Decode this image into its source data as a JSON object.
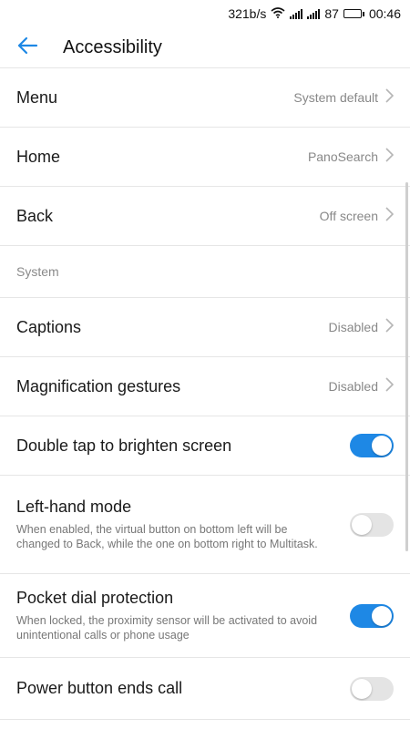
{
  "status_bar": {
    "speed": "321b/s",
    "battery": "87",
    "battery_level": 0.87,
    "time": "00:46"
  },
  "app_bar": {
    "title": "Accessibility"
  },
  "nav_rows": [
    {
      "label": "Menu",
      "value": "System default"
    },
    {
      "label": "Home",
      "value": "PanoSearch"
    },
    {
      "label": "Back",
      "value": "Off screen"
    }
  ],
  "section": {
    "title": "System"
  },
  "system_rows": [
    {
      "label": "Captions",
      "value": "Disabled"
    },
    {
      "label": "Magnification gestures",
      "value": "Disabled"
    }
  ],
  "toggles": [
    {
      "label": "Double tap to brighten screen",
      "desc": "",
      "on": true
    },
    {
      "label": "Left-hand mode",
      "desc": "When enabled, the virtual button on bottom left will be changed to Back, while the one on bottom right to Multitask.",
      "on": false
    },
    {
      "label": "Pocket dial protection",
      "desc": "When locked, the proximity sensor will be activated to avoid unintentional calls or phone usage",
      "on": true
    },
    {
      "label": "Power button ends call",
      "desc": "",
      "on": false
    }
  ],
  "colors": {
    "accent": "#1e88e5",
    "toggle_off": "#e4e4e4"
  },
  "icons": {
    "back": "back-arrow-icon",
    "chevron": "chevron-right-icon",
    "wifi": "wifi-icon",
    "signal": "signal-icon",
    "battery": "battery-icon"
  }
}
